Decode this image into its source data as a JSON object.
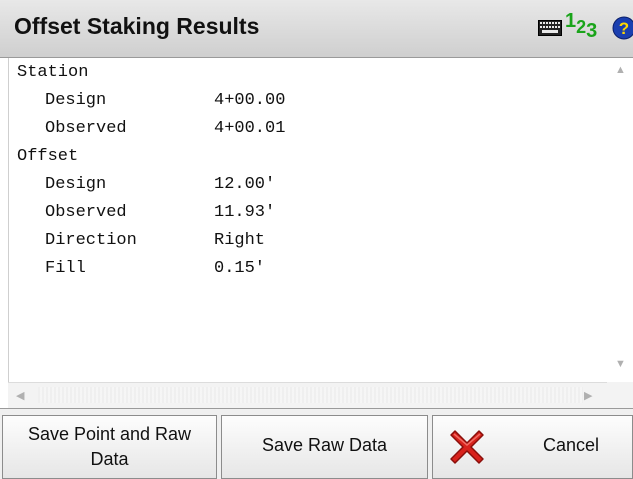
{
  "window": {
    "title": "Offset Staking Results"
  },
  "toolbar_icons": {
    "keyboard": "keyboard-icon",
    "numeric": {
      "d1": "1",
      "d2": "2",
      "d3": "3"
    },
    "help": "help-icon"
  },
  "results": {
    "station": {
      "heading": "Station",
      "design_label": "Design",
      "design_value": "4+00.00",
      "observed_label": "Observed",
      "observed_value": "4+00.01"
    },
    "offset": {
      "heading": "Offset",
      "design_label": "Design",
      "design_value": "12.00'",
      "observed_label": "Observed",
      "observed_value": "11.93'",
      "direction_label": "Direction",
      "direction_value": "Right",
      "fill_label": "Fill",
      "fill_value": "0.15'"
    }
  },
  "buttons": {
    "save_point_line1": "Save Point and Raw",
    "save_point_line2": "Data",
    "save_raw": "Save Raw Data",
    "cancel": "Cancel"
  },
  "colors": {
    "numeric_green": "#1aa41a",
    "help_blue": "#1a3fb0",
    "cancel_red": "#d8221c"
  }
}
